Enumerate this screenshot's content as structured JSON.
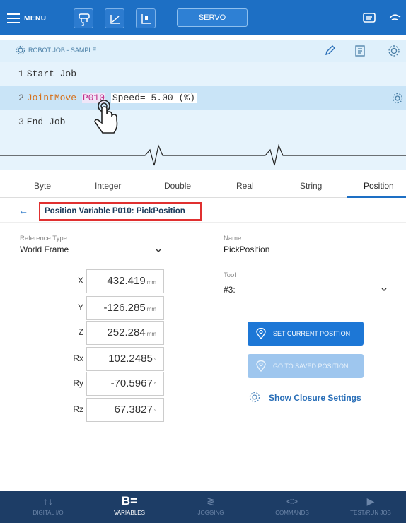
{
  "topbar": {
    "menu_label": "MENU",
    "robot_button_badge": "3",
    "servo_label": "SERVO",
    "icons": [
      "menu-icon",
      "robot-icon",
      "frame-icon",
      "coordinate-icon",
      "chat-icon",
      "hand-icon"
    ]
  },
  "job": {
    "header_title": "ROBOT JOB - SAMPLE",
    "lines": [
      {
        "num": "1",
        "text": "Start Job"
      },
      {
        "num": "2",
        "command": "JointMove",
        "variable": "P010",
        "params": "Speed= 5.00 (%)"
      },
      {
        "num": "3",
        "text": "End Job"
      }
    ]
  },
  "tabs": [
    "Byte",
    "Integer",
    "Double",
    "Real",
    "String",
    "Position"
  ],
  "active_tab": "Position",
  "variable": {
    "title": "Position Variable P010: PickPosition",
    "reference_type_label": "Reference Type",
    "reference_type_value": "World Frame",
    "name_label": "Name",
    "name_value": "PickPosition",
    "tool_label": "Tool",
    "tool_value": "#3:",
    "coords": [
      {
        "axis": "X",
        "value": "432.419",
        "unit": "mm"
      },
      {
        "axis": "Y",
        "value": "-126.285",
        "unit": "mm"
      },
      {
        "axis": "Z",
        "value": "252.284",
        "unit": "mm"
      },
      {
        "axis": "Rx",
        "value": "102.2485",
        "unit": "°"
      },
      {
        "axis": "Ry",
        "value": "-70.5967",
        "unit": "°"
      },
      {
        "axis": "Rz",
        "value": "67.3827",
        "unit": "°"
      }
    ],
    "set_current_position": "SET CURRENT POSITION",
    "go_to_saved_position": "GO TO SAVED POSITION",
    "show_closure_settings": "Show Closure Settings"
  },
  "bottomnav": [
    {
      "label": "DIGITAL I/O",
      "icon": "io-icon"
    },
    {
      "label": "VARIABLES",
      "icon": "B="
    },
    {
      "label": "JOGGING",
      "icon": "jog-icon"
    },
    {
      "label": "COMMANDS",
      "icon": "<>"
    },
    {
      "label": "TEST/RUN JOB",
      "icon": "play-icon"
    }
  ],
  "colors": {
    "primary": "#1d6fc4",
    "nav_bg": "#1d3d66",
    "highlight_border": "#e03030"
  }
}
